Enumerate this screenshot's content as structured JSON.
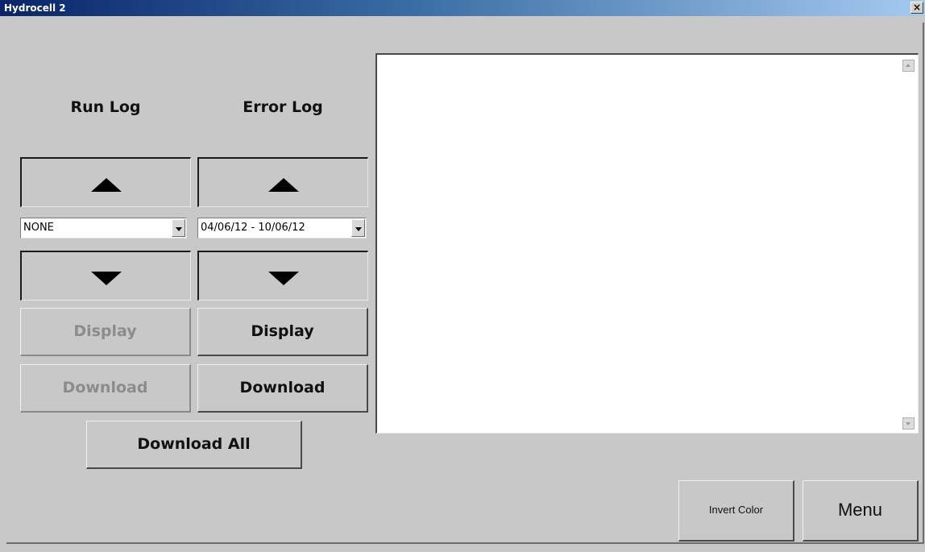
{
  "window": {
    "title": "Hydrocell 2",
    "close_glyph": "×"
  },
  "run_log": {
    "heading": "Run Log",
    "selected": "NONE",
    "display_label": "Display",
    "download_label": "Download",
    "enabled": false
  },
  "error_log": {
    "heading": "Error Log",
    "selected": "04/06/12 - 10/06/12",
    "display_label": "Display",
    "download_label": "Download",
    "enabled": true
  },
  "download_all_label": "Download All",
  "invert_color_label": "Invert Color",
  "menu_label": "Menu",
  "icons": {
    "up": "triangle-up",
    "down": "triangle-down",
    "combo": "chevron-down"
  },
  "colors": {
    "title_gradient_start": "#0a246a",
    "title_gradient_end": "#a6caf0",
    "face": "#c8c8c8",
    "disabled_text": "#8c8c8c"
  }
}
